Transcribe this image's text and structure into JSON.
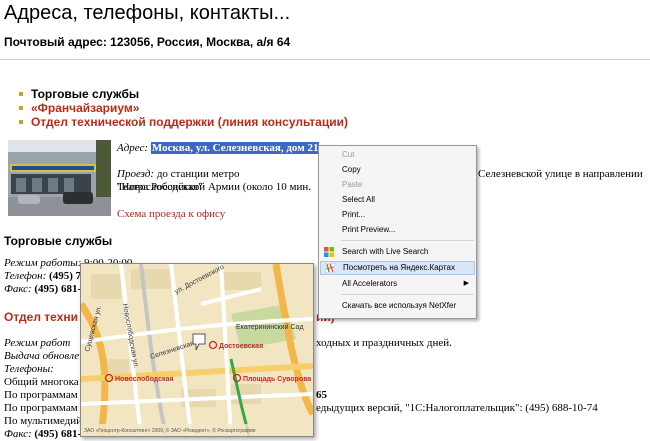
{
  "title": "Адреса, телефоны, контакты...",
  "postal": "Почтовый адрес: 123056, Россия, Москва, а/я 64",
  "nav": [
    {
      "label": "Торговые службы",
      "style": "dark"
    },
    {
      "label": "«Франчайзариум»",
      "style": "red"
    },
    {
      "label": "Отдел технической поддержки (линия консультации)",
      "style": "red"
    }
  ],
  "address": {
    "label": "Адрес:",
    "value": "Москва, ул. Селезневская, дом 21",
    "proezd_label": "Проезд:",
    "proezd_text": "до станции метро \"Новослободская\"",
    "proezd_right": "Селезневской улице в направлении",
    "proezd_line2": "Театра Российской Армии (около 10 мин.",
    "scheme_link": "Схема проезда к офису"
  },
  "sec1": {
    "title": "Торговые службы",
    "lines": [
      {
        "label": "Режим работы:",
        "text": " 9:00-20:00"
      },
      {
        "label": "Телефон:",
        "text": " (495) 7"
      },
      {
        "label": "Факс:",
        "text": " (495) 681-"
      }
    ]
  },
  "sec2": {
    "title": "Отдел техни",
    "title_right": "ии)",
    "lines": [
      {
        "label": "Режим работ",
        "right": "ходных и праздничных дней."
      },
      {
        "label": "Выдача обновле",
        "right": ""
      },
      {
        "label": "Телефоны:",
        "right": ""
      },
      {
        "plain": "Общий многока",
        "right": ""
      },
      {
        "plain": "По программам",
        "right": "65"
      },
      {
        "plain": "По программам",
        "right": "едыдущих версий, \"1С:Налогоплательщик\": (495) 688-10-74"
      },
      {
        "plain": "По мультимедий",
        "right": ""
      },
      {
        "label": "Факс:",
        "text": " (495) 681-44-07"
      }
    ]
  },
  "map": {
    "labels": {
      "ekat": "Екатерининский Сад",
      "dost_street": "ул. Достоевского",
      "dost_metro": "Достоевская",
      "selez": "Селезневская ул.",
      "novo": "Новослободская",
      "suvorov": "Площадь Суворова",
      "novo_street": "Новослободская ул.",
      "suschev": "Сущевская ул.",
      "copyright": "ЗАО «Геоцентр-Консалтинг» 2009, © ЗАО «Резидент», © Роскартография"
    }
  },
  "context_menu": {
    "items": [
      {
        "label": "Cut",
        "disabled": true
      },
      {
        "label": "Copy",
        "disabled": false
      },
      {
        "label": "Paste",
        "disabled": true
      },
      {
        "label": "Select All",
        "disabled": false
      },
      {
        "label": "Print...",
        "disabled": false
      },
      {
        "label": "Print Preview...",
        "disabled": false
      },
      {
        "label": "Search with Live Search",
        "disabled": false,
        "icon": "live-search-icon"
      },
      {
        "label": "Посмотреть на Яндекс.Картах",
        "disabled": false,
        "icon": "yandex-maps-icon",
        "highlighted": true
      },
      {
        "label": "All Accelerators",
        "disabled": false,
        "submenu": true
      },
      {
        "label": "Скачать все используя NetXfer",
        "disabled": false
      }
    ]
  },
  "colors": {
    "accent_red": "#b62b1b",
    "bullet": "#c9a326",
    "highlight": "#3d69c4"
  }
}
